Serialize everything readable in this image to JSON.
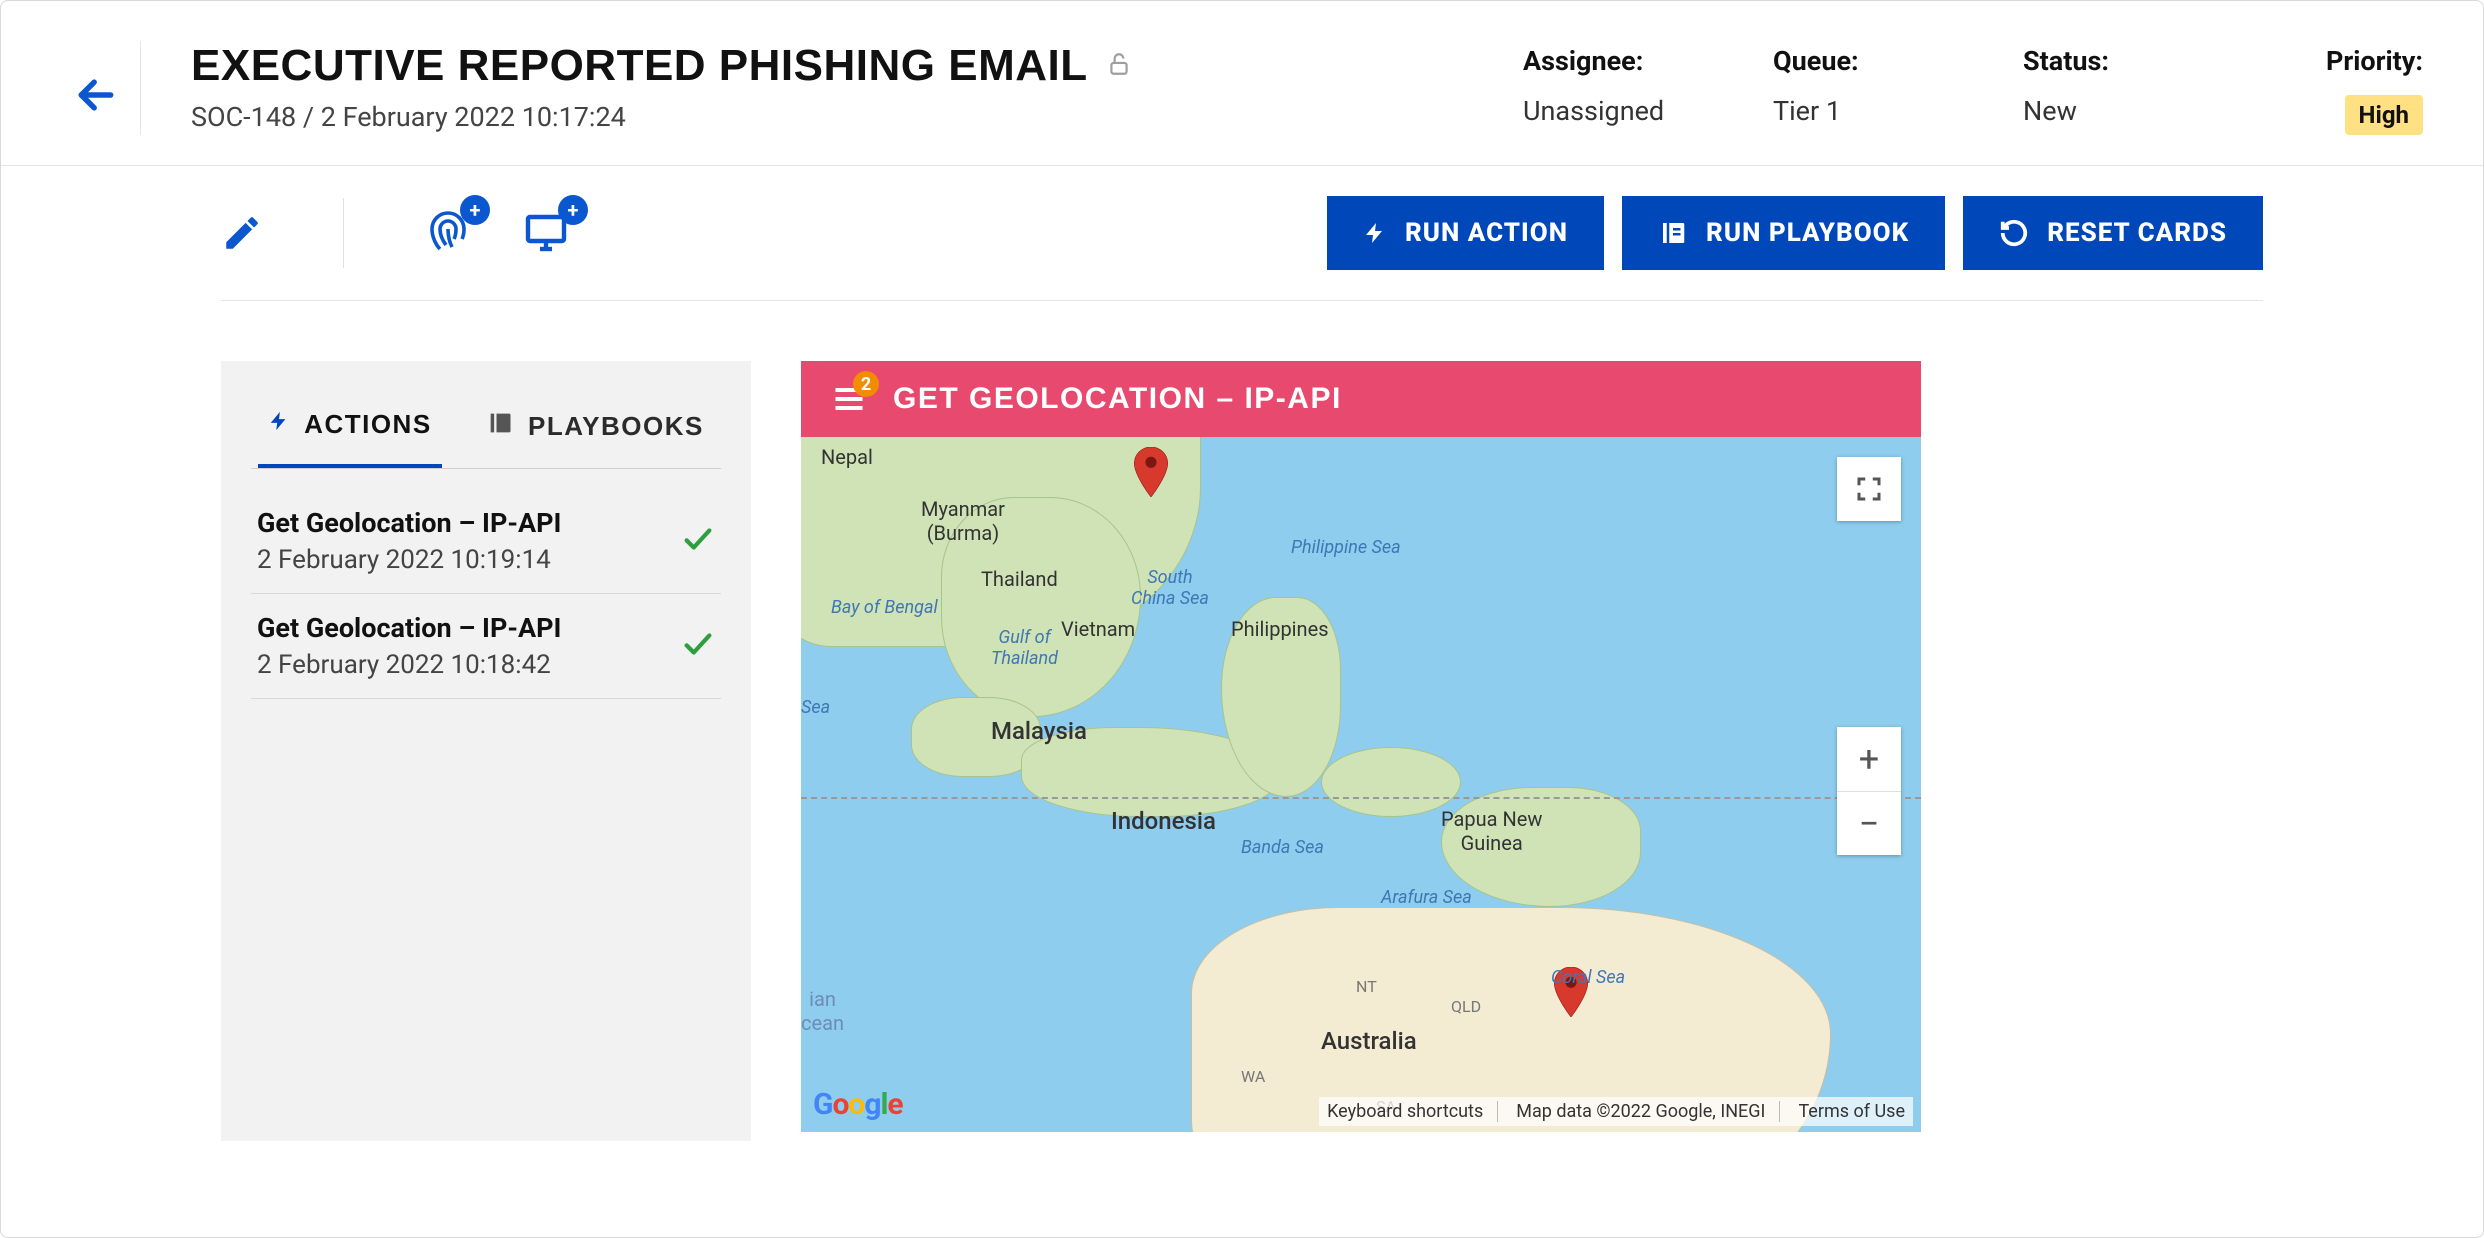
{
  "header": {
    "title": "EXECUTIVE REPORTED PHISHING EMAIL",
    "case_id": "SOC-148",
    "datetime": "2 February 2022 10:17:24",
    "meta": {
      "assignee_label": "Assignee:",
      "assignee_value": "Unassigned",
      "queue_label": "Queue:",
      "queue_value": "Tier 1",
      "status_label": "Status:",
      "status_value": "New",
      "priority_label": "Priority:",
      "priority_value": "High"
    }
  },
  "toolbar": {
    "run_action": "RUN ACTION",
    "run_playbook": "RUN PLAYBOOK",
    "reset_cards": "RESET CARDS"
  },
  "sidebar": {
    "tab_actions": "ACTIONS",
    "tab_playbooks": "PLAYBOOKS",
    "items": [
      {
        "title": "Get Geolocation – IP-API",
        "date": "2 February 2022 10:19:14"
      },
      {
        "title": "Get Geolocation – IP-API",
        "date": "2 February 2022 10:18:42"
      }
    ]
  },
  "map_card": {
    "title": "GET GEOLOCATION – IP-API",
    "badge_count": "2",
    "footer": {
      "shortcuts": "Keyboard shortcuts",
      "data": "Map data ©2022 Google, INEGI",
      "terms": "Terms of Use"
    },
    "labels": {
      "nepal": "Nepal",
      "myanmar": "Myanmar\n(Burma)",
      "thailand": "Thailand",
      "vietnam": "Vietnam",
      "philippines": "Philippines",
      "malaysia": "Malaysia",
      "indonesia": "Indonesia",
      "papua": "Papua New\nGuinea",
      "australia": "Australia",
      "nt": "NT",
      "qld": "QLD",
      "wa": "WA",
      "sa": "SA",
      "philippine_sea": "Philippine Sea",
      "south_china_sea": "South\nChina Sea",
      "bay_bengal": "Bay of Bengal",
      "gulf_thailand": "Gulf of\nThailand",
      "banda_sea": "Banda Sea",
      "arafura_sea": "Arafura Sea",
      "coral_sea": "Coral Sea",
      "ian_ocean": "ian\ncean",
      "sea_left": "Sea"
    }
  }
}
